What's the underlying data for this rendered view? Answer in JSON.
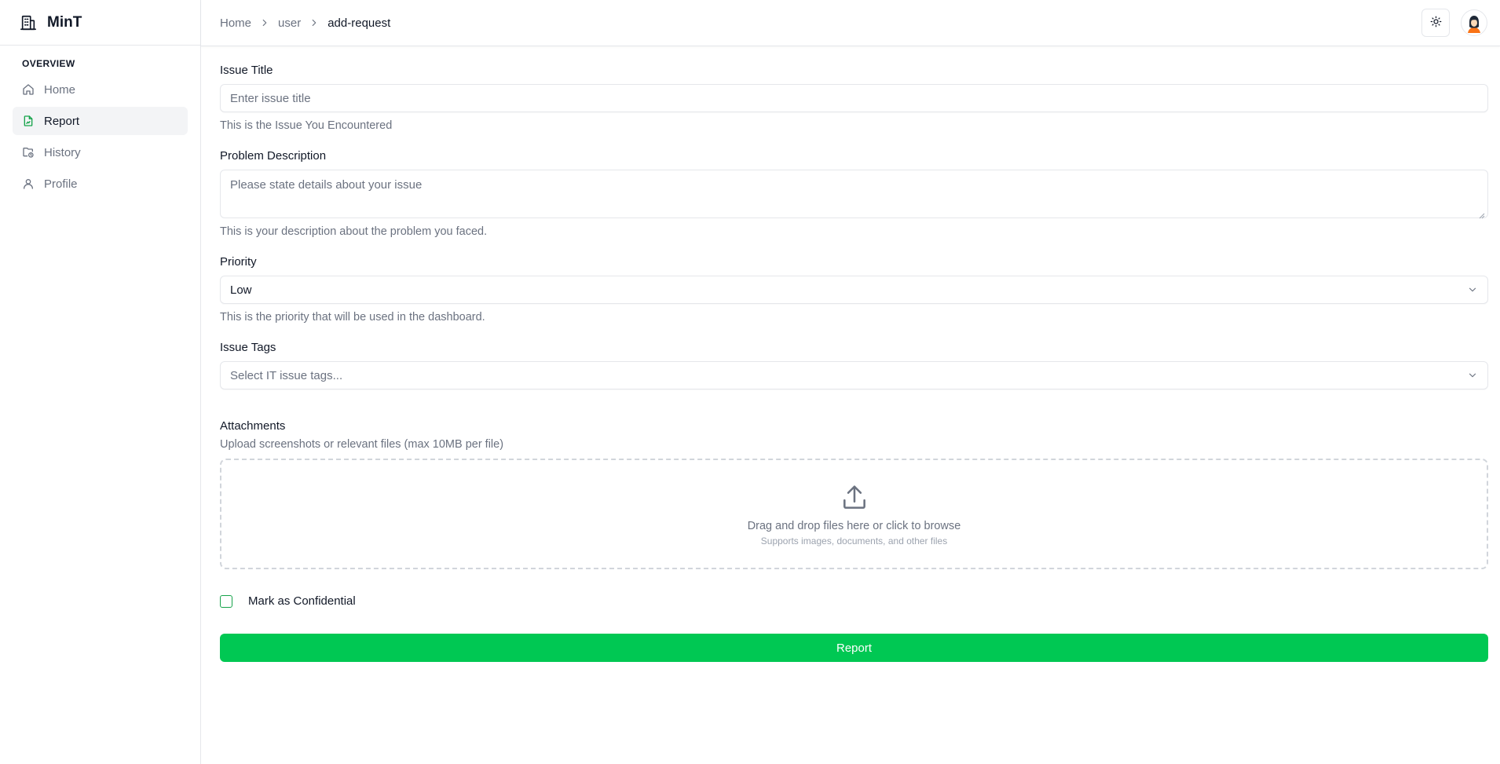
{
  "app": {
    "name": "MinT"
  },
  "sidebar": {
    "group_label": "OVERVIEW",
    "items": [
      {
        "label": "Home",
        "icon": "home-icon"
      },
      {
        "label": "Report",
        "icon": "file-report-icon",
        "active": true
      },
      {
        "label": "History",
        "icon": "folder-clock-icon"
      },
      {
        "label": "Profile",
        "icon": "user-icon"
      }
    ]
  },
  "header": {
    "breadcrumb": [
      "Home",
      "user",
      "add-request"
    ]
  },
  "form": {
    "issue_title": {
      "label": "Issue Title",
      "placeholder": "Enter issue title",
      "help": "This is the Issue You Encountered"
    },
    "description": {
      "label": "Problem Description",
      "placeholder": "Please state details about your issue",
      "help": "This is your description about the problem you faced."
    },
    "priority": {
      "label": "Priority",
      "value": "Low",
      "help": "This is the priority that will be used in the dashboard."
    },
    "tags": {
      "label": "Issue Tags",
      "placeholder": "Select IT issue tags..."
    },
    "attachments": {
      "label": "Attachments",
      "help": "Upload screenshots or relevant files (max 10MB per file)",
      "drop_main": "Drag and drop files here or click to browse",
      "drop_sub": "Supports images, documents, and other files"
    },
    "confidential": {
      "label": "Mark as Confidential",
      "checked": false
    },
    "submit_label": "Report"
  },
  "colors": {
    "accent": "#00c853",
    "checkbox_border": "#16a34a"
  }
}
